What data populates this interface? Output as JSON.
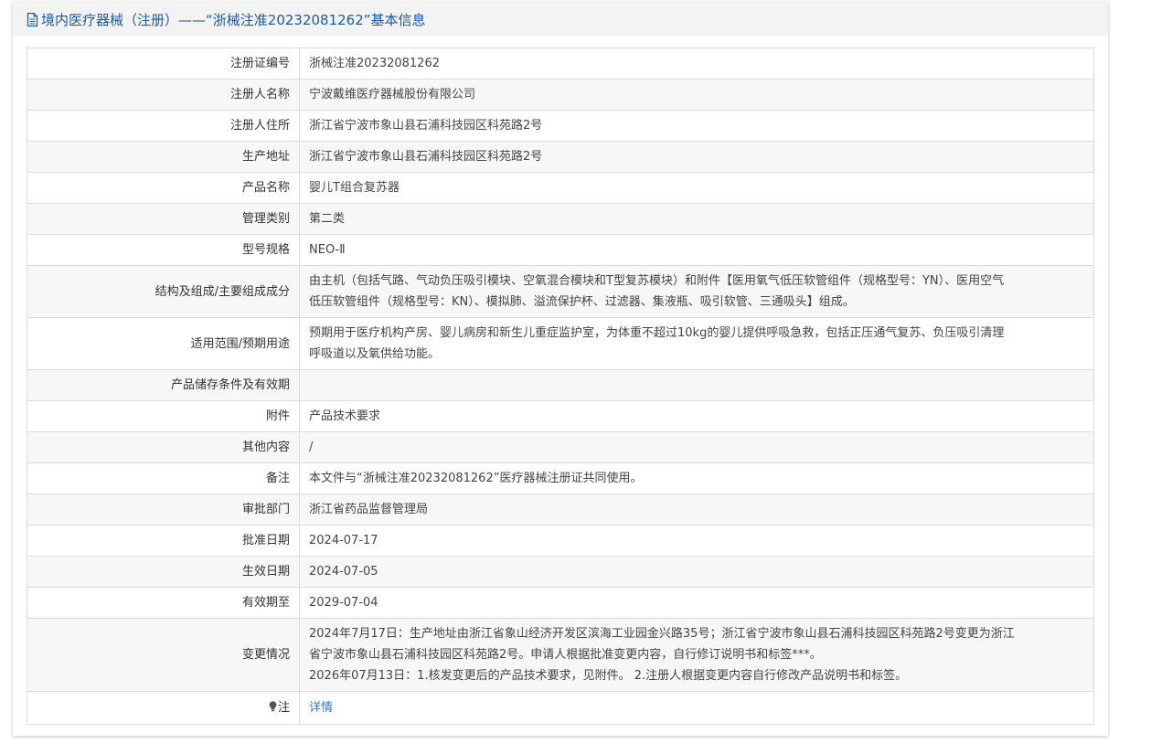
{
  "header": {
    "title": "境内医疗器械（注册）——“浙械注准20232081262”基本信息"
  },
  "rows": [
    {
      "label": "注册证编号",
      "value": "浙械注准20232081262"
    },
    {
      "label": "注册人名称",
      "value": "宁波戴维医疗器械股份有限公司"
    },
    {
      "label": "注册人住所",
      "value": "浙江省宁波市象山县石浦科技园区科苑路2号"
    },
    {
      "label": "生产地址",
      "value": "浙江省宁波市象山县石浦科技园区科苑路2号"
    },
    {
      "label": "产品名称",
      "value": "婴儿T组合复苏器"
    },
    {
      "label": "管理类别",
      "value": "第二类"
    },
    {
      "label": "型号规格",
      "value": "NEO-Ⅱ"
    },
    {
      "label": "结构及组成/主要组成成分",
      "value_lines": [
        "由主机（包括气路、气动负压吸引模块、空氧混合模块和T型复苏模块）和附件【医用氧气低压软管组件（规格型号：YN）、医用空气",
        "低压软管组件（规格型号：KN）、模拟肺、溢流保护杯、过滤器、集液瓶、吸引软管、三通吸头】组成。"
      ]
    },
    {
      "label": "适用范围/预期用途",
      "value_lines": [
        "预期用于医疗机构产房、婴儿病房和新生儿重症监护室，为体重不超过10kg的婴儿提供呼吸急救，包括正压通气复苏、负压吸引清理",
        "呼吸道以及氧供给功能。"
      ]
    },
    {
      "label": "产品储存条件及有效期",
      "value": ""
    },
    {
      "label": "附件",
      "value": "产品技术要求"
    },
    {
      "label": "其他内容",
      "value": "/"
    },
    {
      "label": "备注",
      "value": "本文件与“浙械注准20232081262”医疗器械注册证共同使用。"
    },
    {
      "label": "审批部门",
      "value": "浙江省药品监督管理局"
    },
    {
      "label": "批准日期",
      "value": "2024-07-17"
    },
    {
      "label": "生效日期",
      "value": "2024-07-05"
    },
    {
      "label": "有效期至",
      "value": "2029-07-04"
    },
    {
      "label": "变更情况",
      "value_lines": [
        "2024年7月17日：生产地址由浙江省象山经济开发区滨海工业园金兴路35号；浙江省宁波市象山县石浦科技园区科苑路2号变更为浙江",
        "省宁波市象山县石浦科技园区科苑路2号。申请人根据批准变更内容，自行修订说明书和标签***。",
        "2026年07月13日：1.核发变更后的产品技术要求，见附件。 2.注册人根据变更内容自行修改产品说明书和标签。"
      ]
    }
  ],
  "note_row": {
    "label": "注",
    "icon": "lightbulb-icon",
    "link_label": "详情"
  },
  "colors": {
    "header_text": "#1a5a9e",
    "link": "#2a7ad0",
    "border": "#dcdcdc"
  }
}
